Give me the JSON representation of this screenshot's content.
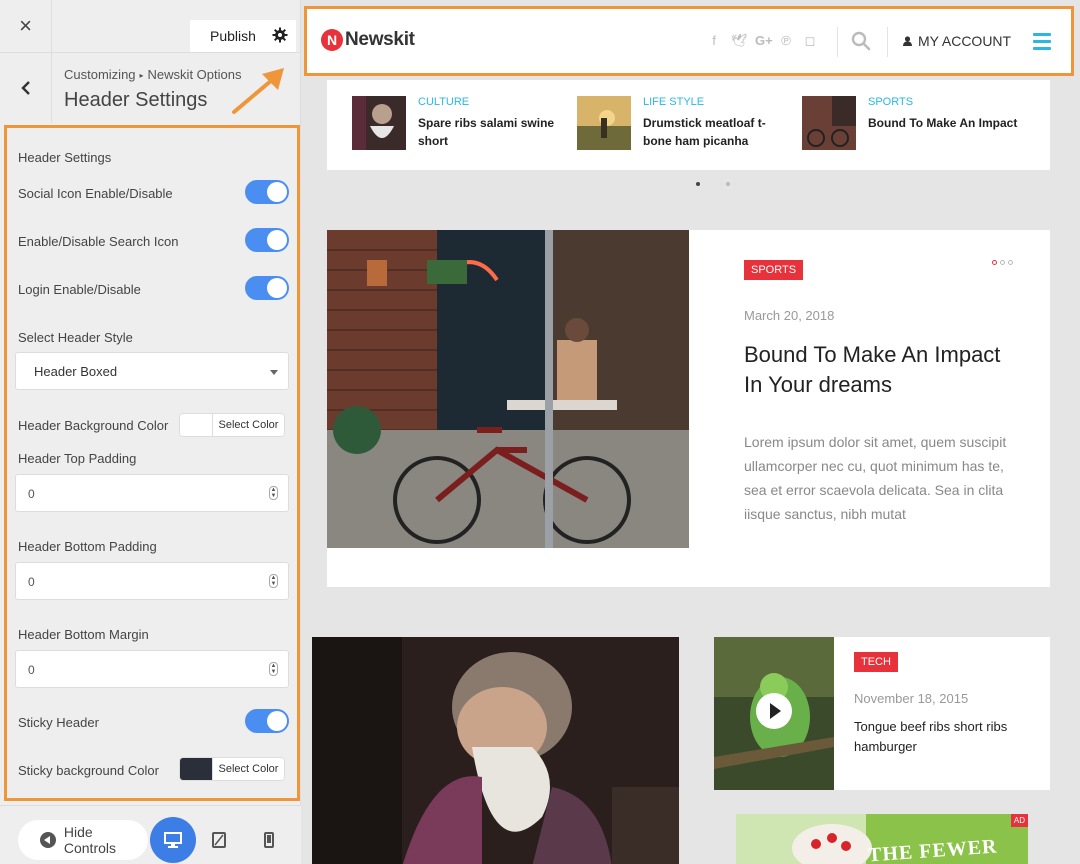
{
  "customizer": {
    "close_label": "×",
    "publish_label": "Publish",
    "breadcrumb_root": "Customizing",
    "breadcrumb_section": "Newskit Options",
    "panel_title": "Header Settings",
    "section_heading": "Header Settings",
    "social_toggle_label": "Social Icon Enable/Disable",
    "search_toggle_label": "Enable/Disable Search Icon",
    "login_toggle_label": "Login Enable/Disable",
    "header_style_label": "Select Header Style",
    "header_style_value": "Header Boxed",
    "bg_color_label": "Header Background Color",
    "bg_color_button": "Select Color",
    "bg_color_value": "#ffffff",
    "top_padding_label": "Header Top Padding",
    "top_padding_value": "0",
    "bottom_padding_label": "Header Bottom Padding",
    "bottom_padding_value": "0",
    "bottom_margin_label": "Header Bottom Margin",
    "bottom_margin_value": "0",
    "sticky_label": "Sticky Header",
    "sticky_bg_label": "Sticky background Color",
    "sticky_bg_button": "Select Color",
    "sticky_bg_value": "#2b2f3a",
    "hide_controls_label": "Hide Controls",
    "toggles": {
      "social": true,
      "search": true,
      "login": true,
      "sticky": true
    }
  },
  "site": {
    "logo_mark": "N",
    "logo_text": "Newskit",
    "account_label": "MY ACCOUNT",
    "ticker": [
      {
        "category": "CULTURE",
        "title": "Spare ribs salami swine short"
      },
      {
        "category": "LIFE STYLE",
        "title": "Drumstick meatloaf t-bone ham picanha"
      },
      {
        "category": "SPORTS",
        "title": "Bound To Make An Impact"
      }
    ],
    "feature": {
      "category": "SPORTS",
      "date": "March 20, 2018",
      "title": "Bound To Make An Impact In Your dreams",
      "excerpt": "Lorem ipsum dolor sit amet, quem suscipit ullamcorper nec cu, quot minimum has te, sea et error scaevola delicata. Sea in clita iisque sanctus, nibh mutat"
    },
    "tech_card": {
      "category": "TECH",
      "date": "November 18, 2015",
      "title": "Tongue beef ribs short ribs hamburger"
    },
    "ad_badge": "AD",
    "ad_text": "THE FEWER"
  },
  "colors": {
    "accent_orange": "#f0963a",
    "toggle_blue": "#4b8ef1",
    "brand_red": "#e8323b",
    "link_cyan": "#2ab7e6"
  }
}
